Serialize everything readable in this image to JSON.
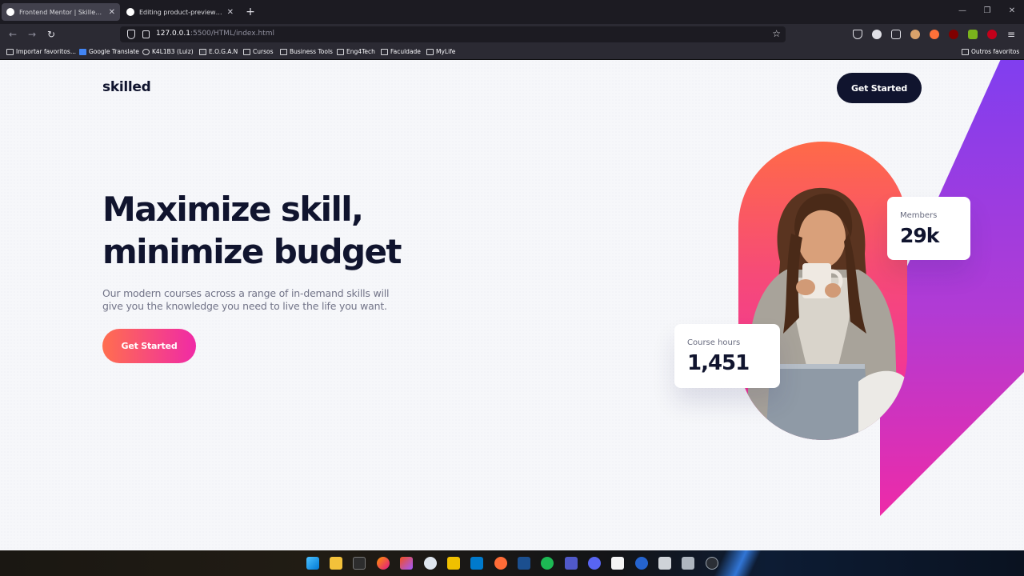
{
  "browser": {
    "tabs": [
      {
        "title": "Frontend Mentor | Skilled e-learning landing page",
        "active": true,
        "icon_color": "#ffffff"
      },
      {
        "title": "Editing product-preview-card-component",
        "active": false,
        "icon_color": "#ffffff"
      }
    ],
    "new_tab_label": "+",
    "url": {
      "host": "127.0.0.1",
      "rest": ":5500/HTML/index.html"
    },
    "bookmarks": [
      "Importar favoritos...",
      "Google Translate",
      "K4L1B3 (Luiz)",
      "E.O.G.A.N",
      "Cursos",
      "Business Tools",
      "Eng4Tech",
      "Faculdade",
      "MyLife"
    ],
    "other_bookmarks": "Outros favoritos",
    "window_controls": [
      "—",
      "❐",
      "✕"
    ]
  },
  "page": {
    "logo": "skilled",
    "header_cta": "Get Started",
    "hero": {
      "title_line1": "Maximize skill,",
      "title_line2": "minimize budget",
      "text": "Our modern courses across a range of in-demand skills will give you the knowledge you need to live the life you want.",
      "cta": "Get Started"
    },
    "stats": {
      "members": {
        "label": "Members",
        "value": "29k"
      },
      "course_hours": {
        "label": "Course hours",
        "value": "1,451"
      }
    },
    "colors": {
      "navy": "#10142e",
      "gradient_start": "#ff6e4f",
      "gradient_end": "#f02aa6",
      "diagonal_purple": "#7f3ef0"
    }
  },
  "taskbar": {
    "icons": [
      "windows-start-icon",
      "file-explorer-icon",
      "terminal-icon",
      "firefox-icon",
      "figma-icon",
      "vscode-icon",
      "postman-icon",
      "spotify-icon",
      "teams-icon",
      "discord-icon",
      "typora-icon",
      "todo-icon",
      "calculator-icon",
      "clock-icon"
    ]
  }
}
